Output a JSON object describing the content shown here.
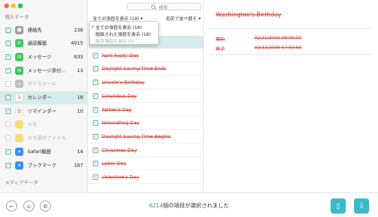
{
  "window": {
    "light_colors": [
      "#ff5f57",
      "#febc2e",
      "#28c840"
    ]
  },
  "sidebar": {
    "section_personal": "個人データ",
    "section_media": "メディアデータ",
    "items": [
      {
        "label": "連絡先",
        "count": "238",
        "checked": true,
        "icon": "contacts-icon",
        "icon_color": "#9c9c9c",
        "glyph": "☻",
        "dim": false,
        "active": false
      },
      {
        "label": "通話履歴",
        "count": "4915",
        "checked": true,
        "icon": "phone-icon",
        "icon_color": "#43c35e",
        "glyph": "✆",
        "dim": false,
        "active": false
      },
      {
        "label": "メッセージ",
        "count": "833",
        "checked": true,
        "icon": "messages-icon",
        "icon_color": "#43c35e",
        "glyph": "✉",
        "dim": false,
        "active": false
      },
      {
        "label": "メッセージ添付...",
        "count": "13",
        "checked": true,
        "icon": "message-attachment-icon",
        "icon_color": "#43c35e",
        "glyph": "✉",
        "dim": false,
        "active": false
      },
      {
        "label": "ボイスメール",
        "count": "",
        "checked": false,
        "icon": "voicemail-icon",
        "icon_color": "#bfbfbf",
        "glyph": "∞",
        "dim": true,
        "active": false
      },
      {
        "label": "カレンダー",
        "count": "18",
        "checked": true,
        "icon": "calendar-icon",
        "icon_color": "#ffffff",
        "glyph": "3",
        "dim": false,
        "active": true
      },
      {
        "label": "リマインダー",
        "count": "10",
        "checked": true,
        "icon": "reminders-icon",
        "icon_color": "#ffffff",
        "glyph": "☰",
        "dim": false,
        "active": false
      },
      {
        "label": "メモ",
        "count": "",
        "checked": false,
        "icon": "notes-icon",
        "icon_color": "#f3dc7a",
        "glyph": "",
        "dim": true,
        "active": false
      },
      {
        "label": "メモ添付ファイル",
        "count": "",
        "checked": false,
        "icon": "notes-attachment-icon",
        "icon_color": "#f3dc7a",
        "glyph": "",
        "dim": true,
        "active": false
      },
      {
        "label": "Safari履歴",
        "count": "14",
        "checked": true,
        "icon": "safari-icon",
        "icon_color": "#3b8ef0",
        "glyph": "✦",
        "dim": false,
        "active": false
      },
      {
        "label": "ブックマーク",
        "count": "167",
        "checked": true,
        "icon": "bookmarks-icon",
        "icon_color": "#3b8ef0",
        "glyph": "✦",
        "dim": false,
        "active": false
      }
    ]
  },
  "list": {
    "search_placeholder": "検索",
    "filter_label": "全ての項目を表示 (18) ▾",
    "sort_label": "名前で並べ替え ▾",
    "rows": [
      {
        "label": "Washington's Birthday",
        "selected": true
      },
      {
        "label": "April Fools' Day",
        "selected": false
      },
      {
        "label": "Daylight Saving Time Ends",
        "selected": false
      },
      {
        "label": "Lincoln's Birthday",
        "selected": false
      },
      {
        "label": "Columbus Day",
        "selected": false
      },
      {
        "label": "Father's Day",
        "selected": false
      },
      {
        "label": "Groundhog Day",
        "selected": false
      },
      {
        "label": "Daylight Saving Time Begins",
        "selected": false
      },
      {
        "label": "Christmas Day",
        "selected": false
      },
      {
        "label": "Labor Day",
        "selected": false
      },
      {
        "label": "Valentine's Day",
        "selected": false
      }
    ]
  },
  "dropdown": {
    "options": [
      {
        "label": "全ての項目を表示 (18)",
        "checked": true,
        "disabled": false
      },
      {
        "label": "削除された項目を表示 (18)",
        "checked": false,
        "disabled": false
      },
      {
        "label": "既存項目を表示 (0)",
        "checked": false,
        "disabled": true
      }
    ]
  },
  "detail": {
    "title": "Washington's Birthday",
    "start_label": "開始",
    "start_value": "02/21/2005 08:00:00",
    "end_label": "終了",
    "end_value": "02/22/2005 07:59:59"
  },
  "bottom": {
    "count": "6214",
    "status_suffix": "個の項目が選択されました"
  },
  "colors": {
    "accent": "#3cb9c6",
    "check": "#2c9c80",
    "deleted_text": "#d93a2b",
    "selected_bg": "#d6ecec"
  }
}
